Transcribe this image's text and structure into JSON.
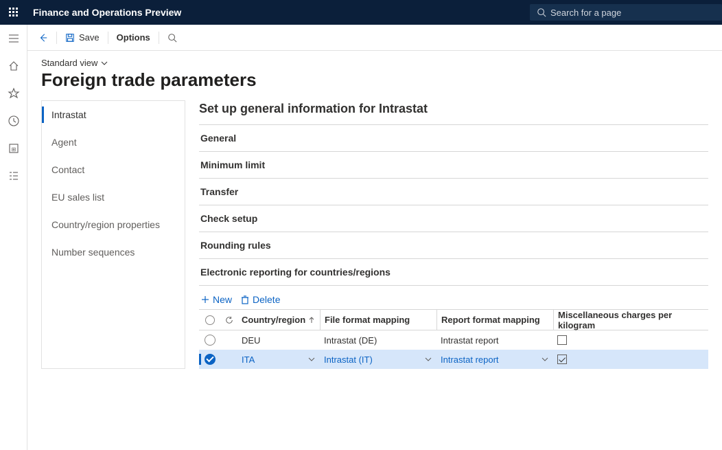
{
  "header": {
    "brand": "Finance and Operations Preview",
    "search_placeholder": "Search for a page"
  },
  "actionbar": {
    "save": "Save",
    "options": "Options"
  },
  "page": {
    "standard_view": "Standard view",
    "title": "Foreign trade parameters"
  },
  "vtabs": [
    "Intrastat",
    "Agent",
    "Contact",
    "EU sales list",
    "Country/region properties",
    "Number sequences"
  ],
  "detail": {
    "title": "Set up general information for Intrastat",
    "sections": [
      "General",
      "Minimum limit",
      "Transfer",
      "Check setup",
      "Rounding rules",
      "Electronic reporting for countries/regions"
    ]
  },
  "grid": {
    "toolbar": {
      "new": "New",
      "delete": "Delete"
    },
    "columns": {
      "country": "Country/region",
      "file": "File format mapping",
      "report": "Report format mapping",
      "misc": "Miscellaneous charges per kilogram"
    },
    "rows": [
      {
        "selected": false,
        "country": "DEU",
        "file": "Intrastat (DE)",
        "report": "Intrastat report",
        "misc": false
      },
      {
        "selected": true,
        "country": "ITA",
        "file": "Intrastat (IT)",
        "report": "Intrastat report",
        "misc": true
      }
    ]
  }
}
